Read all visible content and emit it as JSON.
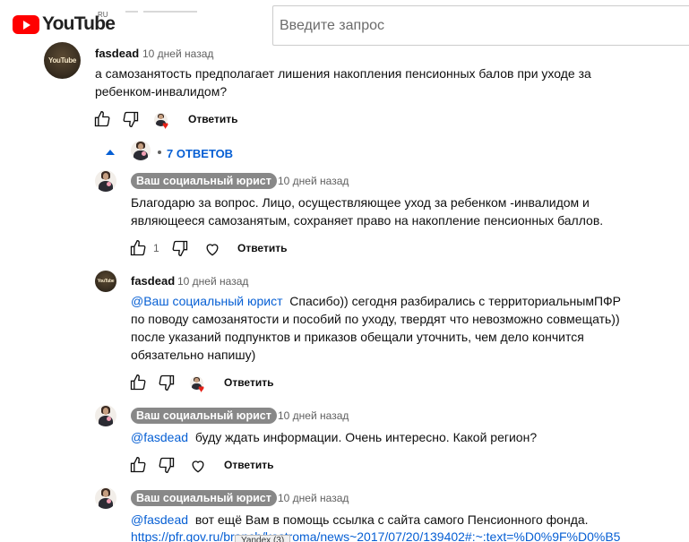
{
  "header": {
    "logo_text": "YouTube",
    "region": "RU",
    "search_placeholder": "Введите запрос"
  },
  "top_comment": {
    "author": "fasdead",
    "avatar_text": "YouTube",
    "time": "10 дней назад",
    "text_line1": "а самозанятость предполагает лишения накопления пенсионных балов при уходе за",
    "text_line2": "ребенком-инвалидом?",
    "reply_label": "Ответить"
  },
  "replies_toggle": {
    "label": "7 ОТВЕТОВ"
  },
  "replies": [
    {
      "author": "Ваш социальный юрист",
      "time": "10 дней назад",
      "text_line1": "Благодарю за вопрос. Лицо, осуществляющее уход за ребенком -инвалидом и",
      "text_line2": "являющееся самозанятым, сохраняет право на накопление пенсионных баллов.",
      "like_count": "1",
      "reply_label": "Ответить"
    },
    {
      "author": "fasdead",
      "avatar_text": "YouTube",
      "time": "10 дней назад",
      "mention": "@Ваш социальный юрист",
      "text_line1_rest": "  Спасибо)) сегодня разбирались с территориальнымПФР",
      "text_line2": "по поводу самозанятости и пособий по уходу, твердят что невозможно совмещать))",
      "text_line3": "после указаний подпунктов и приказов обещали уточнить, чем дело кончится",
      "text_line4": "обязательно напишу)",
      "reply_label": "Ответить"
    },
    {
      "author": "Ваш социальный юрист",
      "time": "10 дней назад",
      "mention": "@fasdead",
      "text_rest": "  буду ждать информации. Очень интересно. Какой регион?",
      "reply_label": "Ответить"
    },
    {
      "author": "Ваш социальный юрист",
      "time": "10 дней назад",
      "mention": "@fasdead",
      "text_rest": "  вот ещё Вам в помощь ссылка с сайта самого Пенсионного фонда.",
      "link_text": "https://pfr.gov.ru/branch/kostroma/news~2017/07/20/139402#:~:text=%D0%9F%D0%B5"
    }
  ],
  "tooltip": "Yandex (3)",
  "colors": {
    "accent": "#065fd4",
    "chip_bg": "#888888",
    "brand_red": "#ff0000",
    "heart": "#e62117"
  },
  "icons": [
    "youtube-play-icon",
    "thumb-up-icon",
    "thumb-down-icon",
    "heart-icon",
    "chevron-up-icon"
  ]
}
